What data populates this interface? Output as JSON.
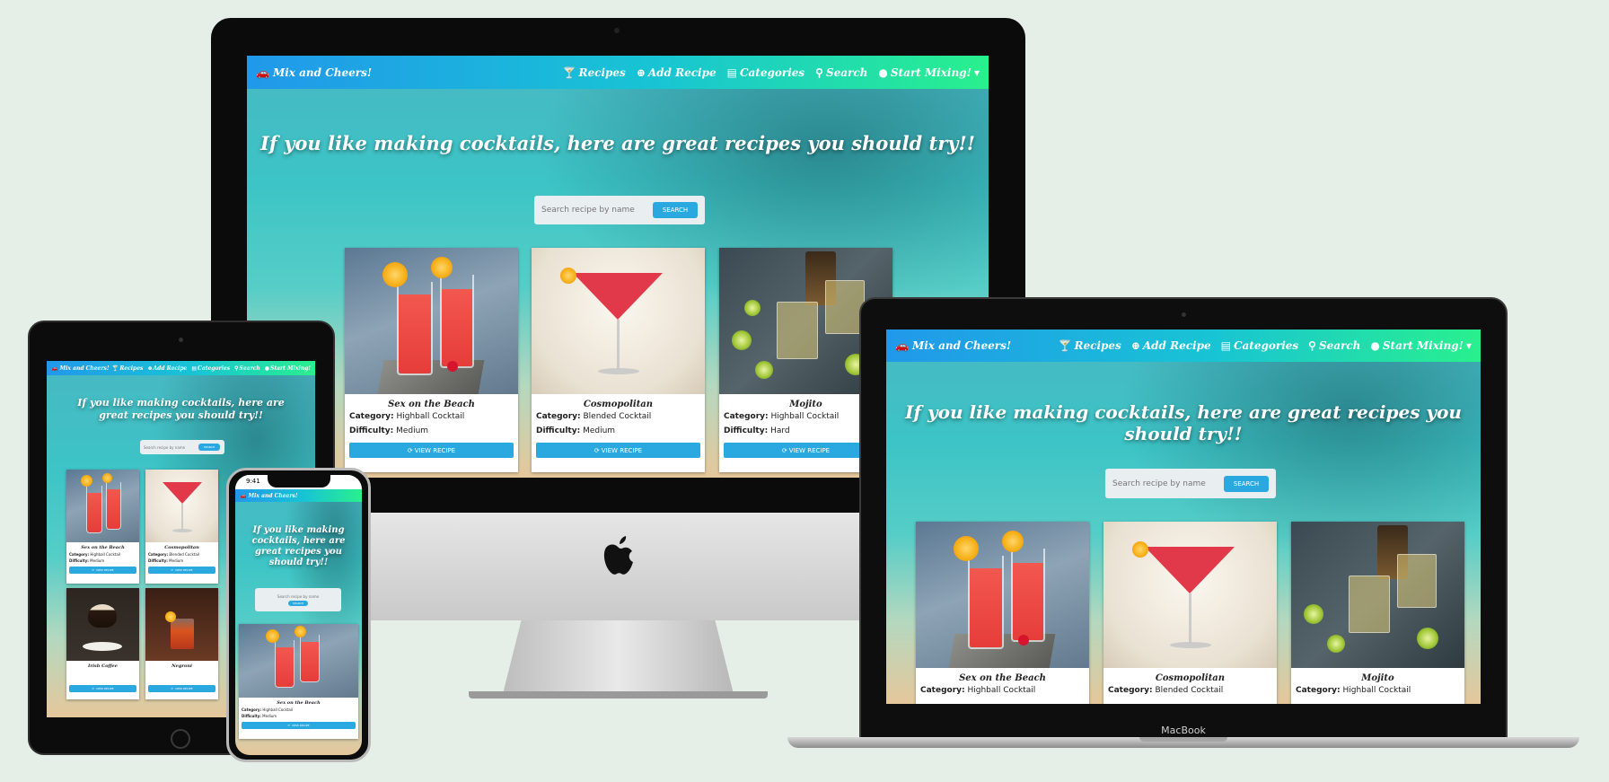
{
  "site": {
    "brand": "Mix and Cheers!",
    "nav": {
      "recipes": "Recipes",
      "add_recipe": "Add Recipe",
      "categories": "Categories",
      "search": "Search",
      "start_mixing": "Start Mixing!"
    },
    "hero": "If you like making cocktails, here are great recipes you should try!!",
    "search_placeholder": "Search recipe by name",
    "search_button": "Search",
    "view_button": "View Recipe",
    "labels": {
      "category": "Category:",
      "difficulty": "Difficulty:"
    },
    "recipes": [
      {
        "name": "Sex on the Beach",
        "category": "Highball Cocktail",
        "difficulty": "Medium"
      },
      {
        "name": "Cosmopolitan",
        "category": "Blended Cocktail",
        "difficulty": "Medium"
      },
      {
        "name": "Mojito",
        "category": "Highball Cocktail",
        "difficulty": "Hard"
      },
      {
        "name": "Irish Coffee"
      },
      {
        "name": "Negroni"
      }
    ]
  },
  "laptop_label": "MacBook",
  "phone_time": "9:41",
  "icons": {
    "brand": "car-icon",
    "recipes": "cocktail-glass-icon",
    "add": "plus-circle-icon",
    "categories": "list-icon",
    "search": "search-icon",
    "mix": "lightbulb-icon",
    "view": "refresh-icon",
    "logo": "apple-logo-icon"
  },
  "colors": {
    "nav_start": "#2198ea",
    "nav_end": "#29f08d",
    "button": "#29a9e0",
    "background": "#e6eee8"
  }
}
